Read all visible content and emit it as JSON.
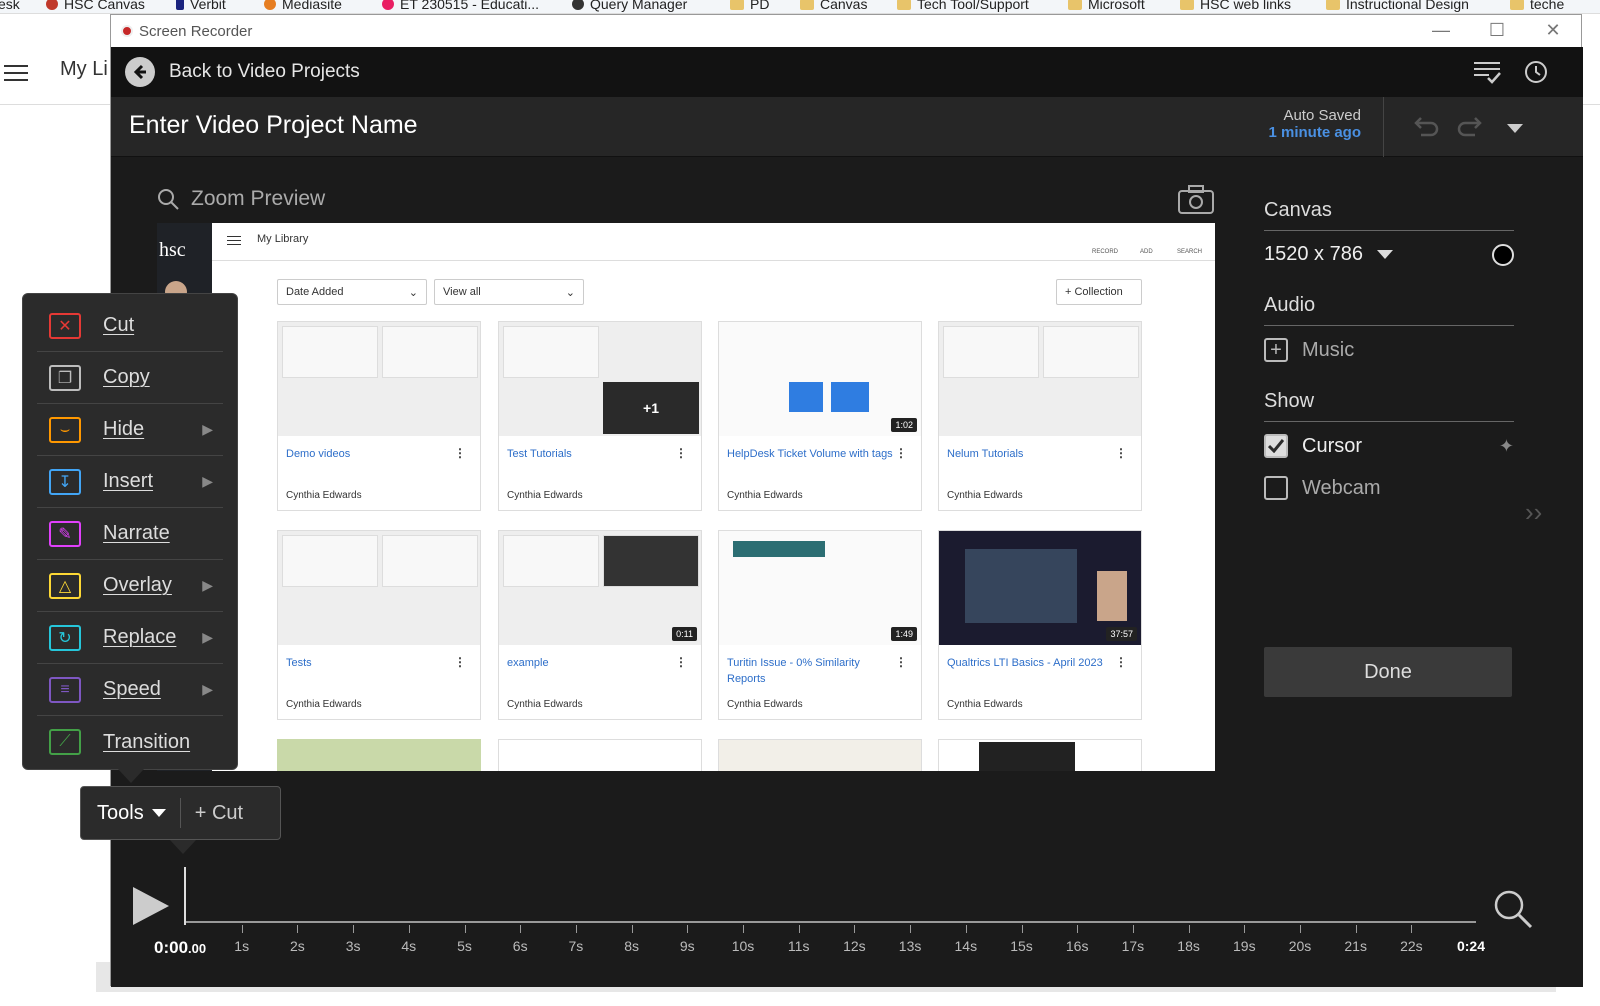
{
  "bookmarks": [
    "esk",
    "HSC Canvas",
    "Verbit",
    "Mediasite",
    "ET 230515 - Educati...",
    "Query Manager",
    "PD",
    "Canvas",
    "Tech Tool/Support",
    "Microsoft",
    "HSC web links",
    "Instructional Design",
    "teche"
  ],
  "background_app": {
    "title": "My Li"
  },
  "window": {
    "title": "Screen Recorder"
  },
  "appbar": {
    "back_label": "Back to Video Projects"
  },
  "header": {
    "project_name": "Enter Video Project Name",
    "auto_saved": "Auto Saved",
    "saved_time": "1 minute ago"
  },
  "preview": {
    "label": "Zoom Preview",
    "page_title": "My Library",
    "logo": "hsc",
    "top_icons": [
      "RECORD",
      "ADD",
      "SEARCH"
    ],
    "filter_sort": "Date Added",
    "filter_view": "View all",
    "collection_button": "Collection",
    "cards": [
      {
        "title": "Demo videos",
        "author": "Cynthia Edwards",
        "duration": ""
      },
      {
        "title": "Test Tutorials",
        "author": "Cynthia Edwards",
        "duration": "",
        "overlay": "+1"
      },
      {
        "title": "HelpDesk Ticket Volume with tags",
        "author": "Cynthia Edwards",
        "duration": "1:02"
      },
      {
        "title": "Nelum Tutorials",
        "author": "Cynthia Edwards",
        "duration": ""
      },
      {
        "title": "Tests",
        "author": "Cynthia Edwards",
        "duration": ""
      },
      {
        "title": "example",
        "author": "Cynthia Edwards",
        "duration": "0:11"
      },
      {
        "title": "Turitin Issue - 0% Similarity Reports",
        "author": "Cynthia Edwards",
        "duration": "1:49"
      },
      {
        "title": "Qualtrics LTI Basics - April 2023",
        "author": "Cynthia Edwards",
        "duration": "37:57"
      }
    ]
  },
  "right_panel": {
    "canvas_heading": "Canvas",
    "canvas_size": "1520 x 786",
    "audio_heading": "Audio",
    "music_label": "Music",
    "show_heading": "Show",
    "cursor_label": "Cursor",
    "cursor_checked": true,
    "webcam_label": "Webcam",
    "webcam_checked": false,
    "done_label": "Done"
  },
  "tools_menu": {
    "items": [
      {
        "label": "Cut",
        "color": "#e53935",
        "submenu": false
      },
      {
        "label": "Copy",
        "color": "#bdbdbd",
        "submenu": false
      },
      {
        "label": "Hide",
        "color": "#ff9800",
        "submenu": true
      },
      {
        "label": "Insert",
        "color": "#42a5f5",
        "submenu": true
      },
      {
        "label": "Narrate",
        "color": "#e040fb",
        "submenu": false
      },
      {
        "label": "Overlay",
        "color": "#fdd835",
        "submenu": true
      },
      {
        "label": "Replace",
        "color": "#26c6da",
        "submenu": true
      },
      {
        "label": "Speed",
        "color": "#7e57c2",
        "submenu": true
      },
      {
        "label": "Transition",
        "color": "#43a047",
        "submenu": false
      }
    ],
    "tools_button": "Tools",
    "cut_button": "Cut"
  },
  "timeline": {
    "current_time": "0:00",
    "current_ms": ".00",
    "ticks": [
      "1s",
      "2s",
      "3s",
      "4s",
      "5s",
      "6s",
      "7s",
      "8s",
      "9s",
      "10s",
      "11s",
      "12s",
      "13s",
      "14s",
      "15s",
      "16s",
      "17s",
      "18s",
      "19s",
      "20s",
      "21s",
      "22s"
    ],
    "end_time": "0:24"
  }
}
